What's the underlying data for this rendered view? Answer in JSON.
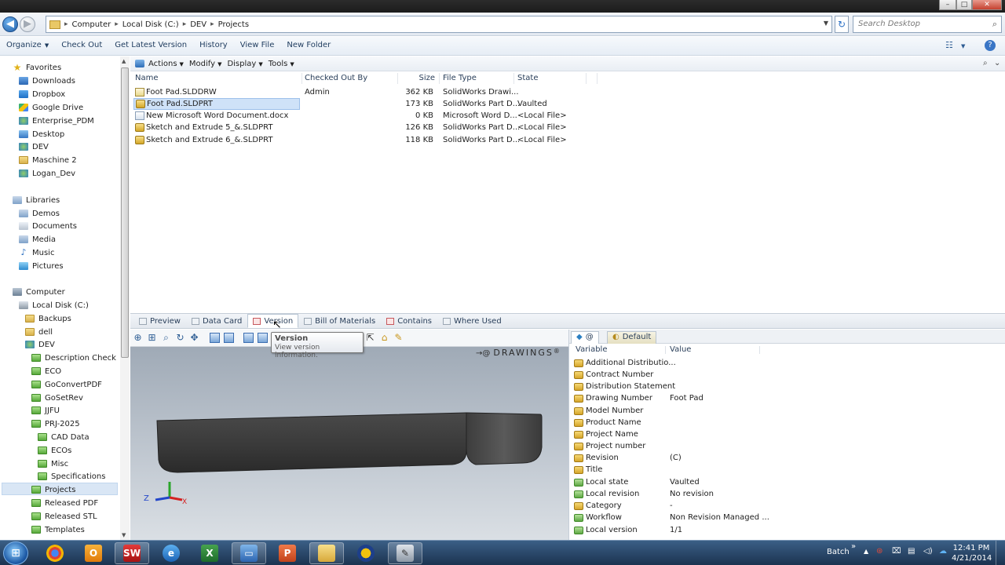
{
  "address": {
    "crumbs": [
      "Computer",
      "Local Disk (C:)",
      "DEV",
      "Projects"
    ],
    "search_placeholder": "Search Desktop"
  },
  "commandbar": {
    "organize": "Organize",
    "check_out": "Check Out",
    "get_latest": "Get Latest Version",
    "history": "History",
    "view_file": "View File",
    "new_folder": "New Folder"
  },
  "pdm_toolbar": {
    "actions": "Actions",
    "modify": "Modify",
    "display": "Display",
    "tools": "Tools"
  },
  "nav": {
    "favorites": {
      "label": "Favorites",
      "items": [
        "Downloads",
        "Dropbox",
        "Google Drive",
        "Enterprise_PDM",
        "Desktop",
        "DEV",
        "Maschine 2",
        "Logan_Dev"
      ]
    },
    "libraries": {
      "label": "Libraries",
      "items": [
        "Demos",
        "Documents",
        "Media",
        "Music",
        "Pictures"
      ]
    },
    "computer": {
      "label": "Computer",
      "local_disk": "Local Disk (C:)",
      "items": [
        "Backups",
        "dell",
        "DEV"
      ],
      "dev_items": [
        "Description Check",
        "ECO",
        "GoConvertPDF",
        "GoSetRev",
        "JJFU",
        "PRJ-2025"
      ],
      "prj_items": [
        "CAD Data",
        "ECOs",
        "Misc",
        "Specifications"
      ],
      "after_items": [
        "Projects",
        "Released PDF",
        "Released STL",
        "Templates"
      ]
    }
  },
  "filelist": {
    "columns": [
      "Name",
      "Checked Out By",
      "Size",
      "File Type",
      "State"
    ],
    "rows": [
      {
        "name": "Foot Pad.SLDDRW",
        "checked_out_by": "Admin",
        "size": "362 KB",
        "type": "SolidWorks Drawi...",
        "state": ""
      },
      {
        "name": "Foot Pad.SLDPRT",
        "checked_out_by": "",
        "size": "173 KB",
        "type": "SolidWorks Part D...",
        "state": "Vaulted"
      },
      {
        "name": "New Microsoft Word Document.docx",
        "checked_out_by": "",
        "size": "0 KB",
        "type": "Microsoft Word D...",
        "state": "<Local File>"
      },
      {
        "name": "Sketch and Extrude 5_&.SLDPRT",
        "checked_out_by": "",
        "size": "126 KB",
        "type": "SolidWorks Part D...",
        "state": "<Local File>"
      },
      {
        "name": "Sketch and Extrude 6_&.SLDPRT",
        "checked_out_by": "",
        "size": "118 KB",
        "type": "SolidWorks Part D...",
        "state": "<Local File>"
      }
    ]
  },
  "tabs": [
    "Preview",
    "Data Card",
    "Version",
    "Bill of Materials",
    "Contains",
    "Where Used"
  ],
  "tooltip": {
    "title": "Version",
    "description": "View version information."
  },
  "preview": {
    "brand": "DRAWINGS",
    "brand_mark": "®",
    "axis_z": "Z",
    "axis_x": "X"
  },
  "datacard": {
    "tab_at": "@",
    "tab_default": "Default",
    "col_variable": "Variable",
    "col_value": "Value",
    "rows": [
      {
        "var": "Additional Distributio...",
        "val": ""
      },
      {
        "var": "Contract Number",
        "val": ""
      },
      {
        "var": "Distribution Statement",
        "val": ""
      },
      {
        "var": "Drawing Number",
        "val": "Foot Pad"
      },
      {
        "var": "Model Number",
        "val": ""
      },
      {
        "var": "Product Name",
        "val": ""
      },
      {
        "var": "Project Name",
        "val": ""
      },
      {
        "var": "Project number",
        "val": ""
      },
      {
        "var": "Revision",
        "val": "(C)"
      },
      {
        "var": "Title",
        "val": ""
      },
      {
        "var": "Local state",
        "val": "Vaulted"
      },
      {
        "var": "Local revision",
        "val": "No revision"
      },
      {
        "var": "Category",
        "val": "-"
      },
      {
        "var": "Workflow",
        "val": "Non Revision Managed ..."
      },
      {
        "var": "Local version",
        "val": "1/1"
      }
    ]
  },
  "taskbar": {
    "batch": "Batch",
    "time": "12:41 PM",
    "date": "4/21/2014",
    "chevron": "»"
  },
  "colors": {
    "selection": "#cfe2f8",
    "taskbar": "#1b3350",
    "link_text": "#1e3b5e"
  }
}
